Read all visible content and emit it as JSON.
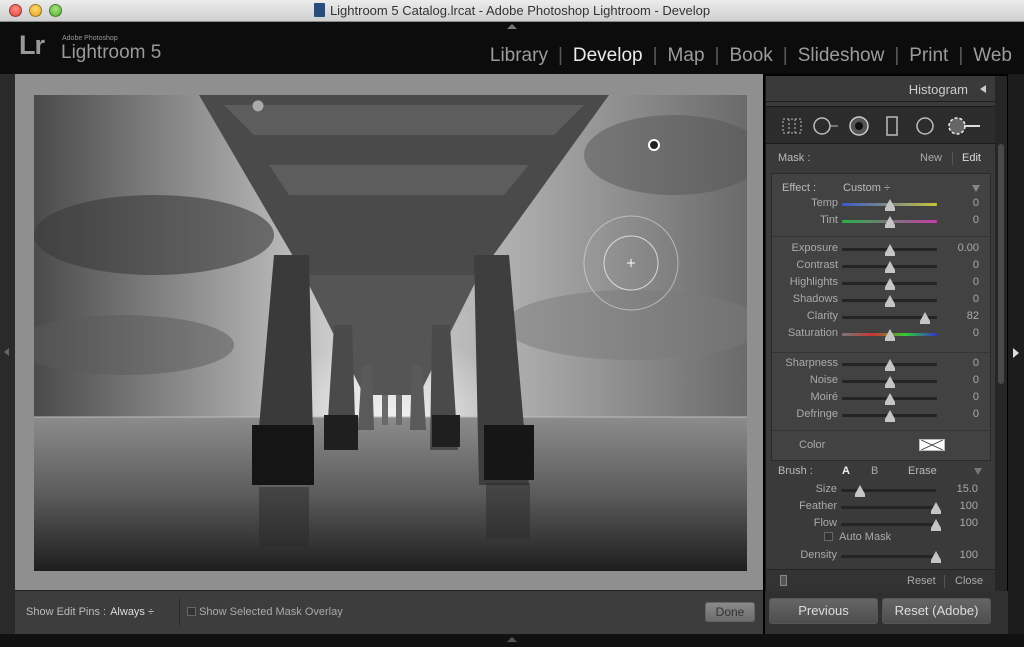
{
  "window": {
    "title": "Lightroom 5 Catalog.lrcat - Adobe Photoshop Lightroom - Develop"
  },
  "identity": {
    "logo": "Lr",
    "sub": "Adobe Photoshop",
    "name": "Lightroom 5"
  },
  "modules": [
    "Library",
    "Develop",
    "Map",
    "Book",
    "Slideshow",
    "Print",
    "Web"
  ],
  "active_module": "Develop",
  "panel": {
    "histogram_title": "Histogram",
    "mask": {
      "label": "Mask :",
      "new": "New",
      "edit": "Edit"
    },
    "effect": {
      "label": "Effect :",
      "value": "Custom ÷"
    },
    "sliders": [
      {
        "label": "Temp",
        "value": "0",
        "pos": 0.5
      },
      {
        "label": "Tint",
        "value": "0",
        "pos": 0.5
      },
      {
        "label": "Exposure",
        "value": "0.00",
        "pos": 0.5
      },
      {
        "label": "Contrast",
        "value": "0",
        "pos": 0.5
      },
      {
        "label": "Highlights",
        "value": "0",
        "pos": 0.5
      },
      {
        "label": "Shadows",
        "value": "0",
        "pos": 0.5
      },
      {
        "label": "Clarity",
        "value": "82",
        "pos": 0.87
      },
      {
        "label": "Saturation",
        "value": "0",
        "pos": 0.5
      },
      {
        "label": "Sharpness",
        "value": "0",
        "pos": 0.5
      },
      {
        "label": "Noise",
        "value": "0",
        "pos": 0.5
      },
      {
        "label": "Moiré",
        "value": "0",
        "pos": 0.5
      },
      {
        "label": "Defringe",
        "value": "0",
        "pos": 0.5
      }
    ],
    "color_label": "Color",
    "brush": {
      "label": "Brush :",
      "a": "A",
      "b": "B",
      "erase": "Erase"
    },
    "brush_sliders": [
      {
        "label": "Size",
        "value": "15.0",
        "pos": 0.2
      },
      {
        "label": "Feather",
        "value": "100",
        "pos": 1.0
      },
      {
        "label": "Flow",
        "value": "100",
        "pos": 1.0
      },
      {
        "label": "Density",
        "value": "100",
        "pos": 1.0
      }
    ],
    "auto_mask": "Auto Mask",
    "reset": "Reset",
    "close": "Close"
  },
  "toolbar": {
    "edit_pins_label": "Show Edit Pins :",
    "edit_pins_value": "Always ÷",
    "mask_overlay": "Show Selected Mask Overlay",
    "done": "Done"
  },
  "buttons": {
    "previous": "Previous",
    "reset_adobe": "Reset (Adobe)"
  },
  "colors": {
    "bg": "#3a3a3a",
    "active_text": "#eaeaea"
  }
}
